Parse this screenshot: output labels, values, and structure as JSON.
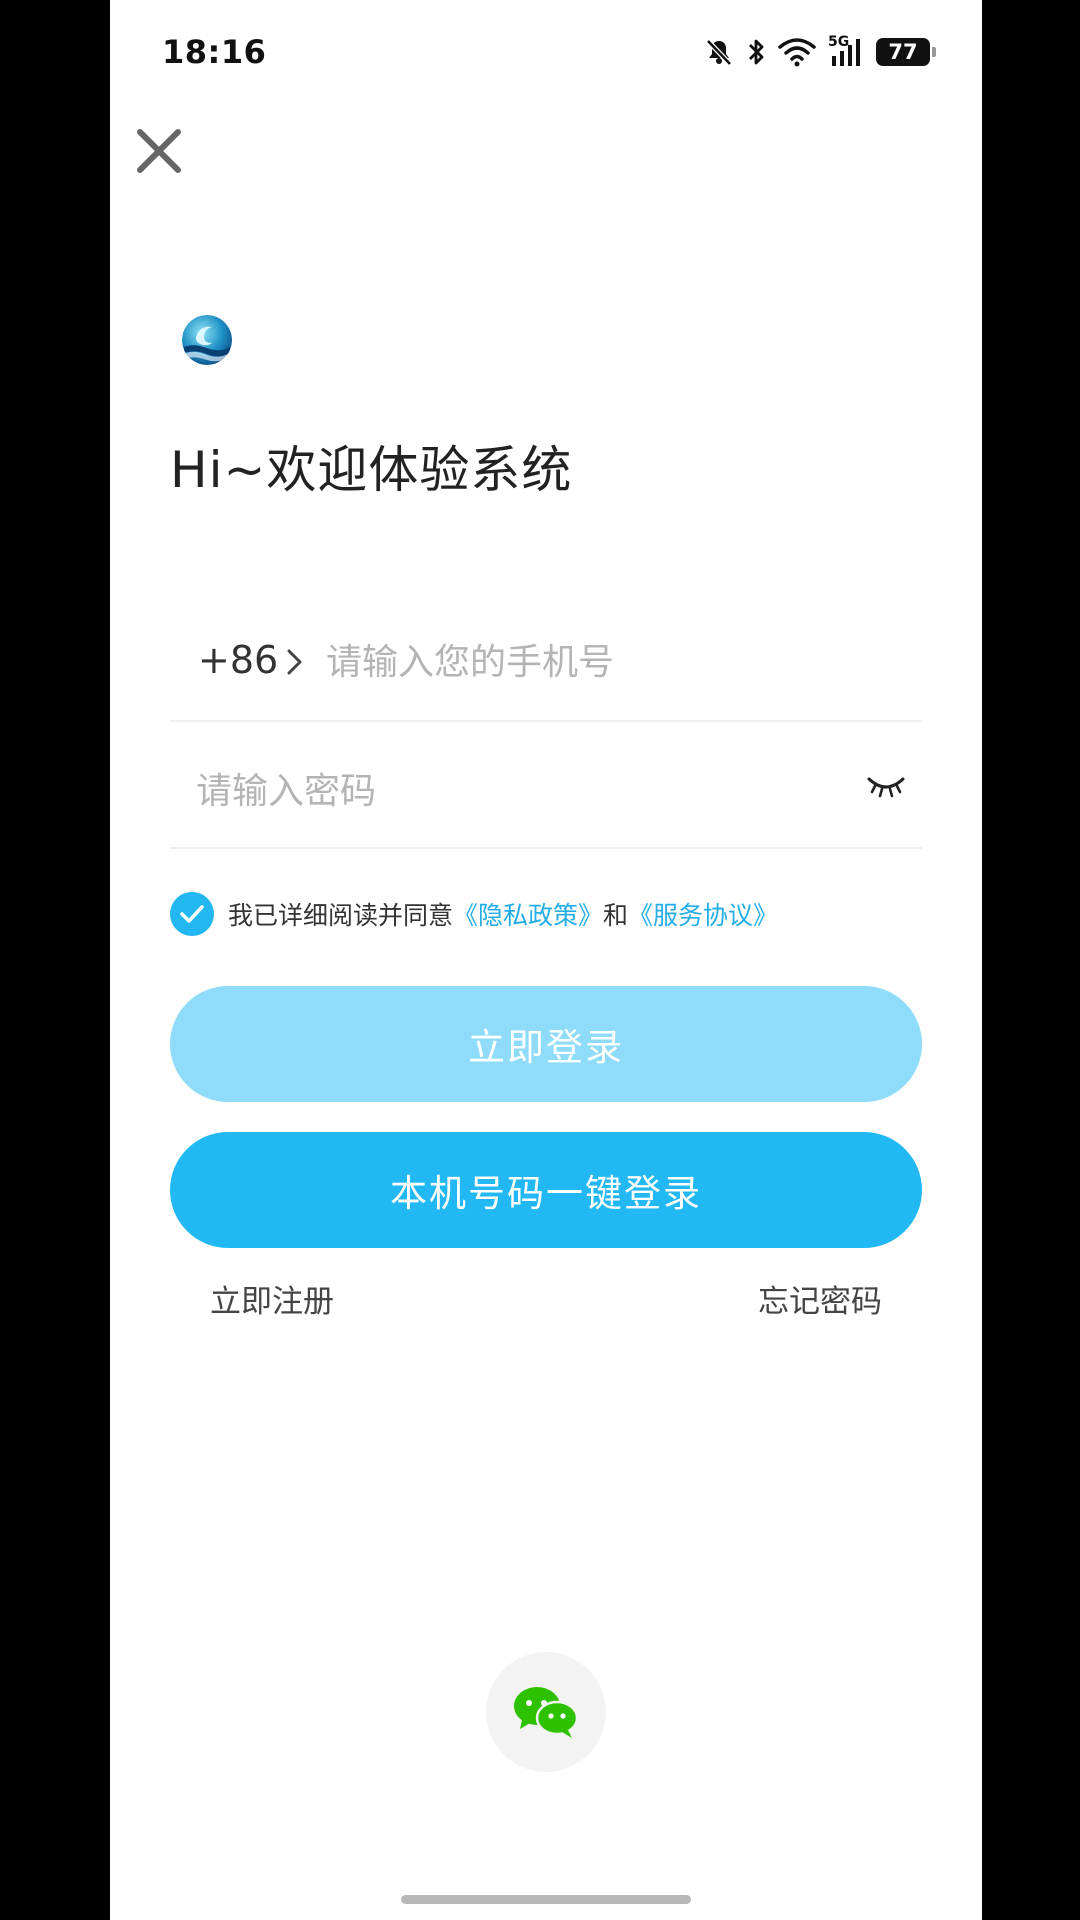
{
  "status_bar": {
    "time": "18:16",
    "network": "5G",
    "battery": "77",
    "icons": [
      "bell-muted-icon",
      "bluetooth-icon",
      "wifi-icon",
      "signal-5g-icon",
      "battery-icon"
    ]
  },
  "header": {
    "close_icon": "close-icon"
  },
  "logo": {
    "icon": "app-logo"
  },
  "welcome": {
    "title": "Hi~欢迎体验系统"
  },
  "phone_field": {
    "country_code": "+86",
    "placeholder": "请输入您的手机号",
    "value": ""
  },
  "password_field": {
    "placeholder": "请输入密码",
    "value": "",
    "toggle_icon": "eye-closed-icon"
  },
  "agreement": {
    "checked": true,
    "text": "我已详细阅读并同意",
    "privacy_link": "《隐私政策》",
    "connector": "和",
    "service_link": "《服务协议》"
  },
  "buttons": {
    "login": "立即登录",
    "one_key_login": "本机号码一键登录"
  },
  "links": {
    "register": "立即注册",
    "forgot_password": "忘记密码"
  },
  "third_party": {
    "wechat_icon": "wechat-icon"
  },
  "colors": {
    "accent": "#22b8f4",
    "accent_light": "#8fdcfa",
    "link": "#23aee6",
    "wechat": "#2dc100"
  }
}
